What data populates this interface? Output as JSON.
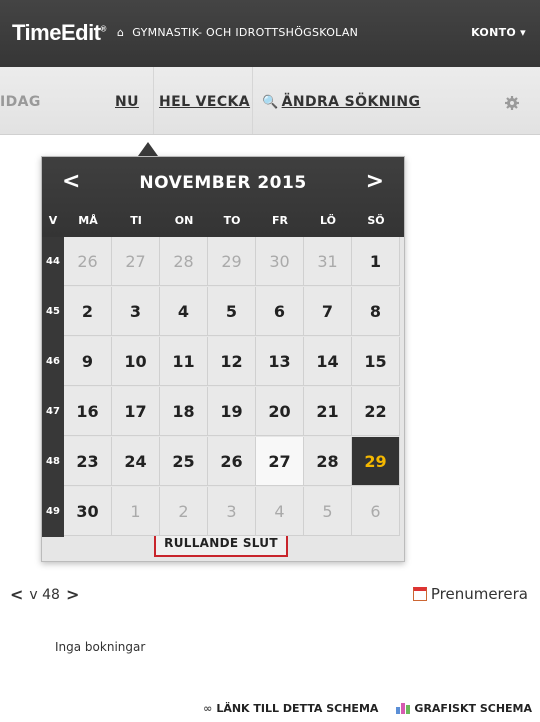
{
  "header": {
    "logo": "TimeEdit",
    "logo_mark": "®",
    "school": "GYMNASTIK- OCH IDROTTSHÖGSKOLAN",
    "account": "KONTO ▾"
  },
  "nav": {
    "idag": "IDAG",
    "nu": "NU",
    "hel_vecka": "HEL VECKA",
    "andra_sokning": "ÄNDRA SÖKNING"
  },
  "calendar": {
    "prev": "<",
    "next": ">",
    "title": "NOVEMBER 2015",
    "week_header": "V",
    "weekdays": [
      "MÅ",
      "TI",
      "ON",
      "TO",
      "FR",
      "LÖ",
      "SÖ"
    ],
    "weeks": [
      {
        "week": "44",
        "days": [
          {
            "d": "26",
            "other": true
          },
          {
            "d": "27",
            "other": true
          },
          {
            "d": "28",
            "other": true
          },
          {
            "d": "29",
            "other": true
          },
          {
            "d": "30",
            "other": true
          },
          {
            "d": "31",
            "other": true
          },
          {
            "d": "1"
          }
        ]
      },
      {
        "week": "45",
        "days": [
          {
            "d": "2"
          },
          {
            "d": "3"
          },
          {
            "d": "4"
          },
          {
            "d": "5"
          },
          {
            "d": "6"
          },
          {
            "d": "7"
          },
          {
            "d": "8"
          }
        ]
      },
      {
        "week": "46",
        "days": [
          {
            "d": "9"
          },
          {
            "d": "10"
          },
          {
            "d": "11"
          },
          {
            "d": "12"
          },
          {
            "d": "13"
          },
          {
            "d": "14"
          },
          {
            "d": "15"
          }
        ]
      },
      {
        "week": "47",
        "days": [
          {
            "d": "16"
          },
          {
            "d": "17"
          },
          {
            "d": "18"
          },
          {
            "d": "19"
          },
          {
            "d": "20"
          },
          {
            "d": "21"
          },
          {
            "d": "22"
          }
        ]
      },
      {
        "week": "48",
        "days": [
          {
            "d": "23"
          },
          {
            "d": "24"
          },
          {
            "d": "25"
          },
          {
            "d": "26"
          },
          {
            "d": "27",
            "today": true
          },
          {
            "d": "28"
          },
          {
            "d": "29",
            "selected": true
          }
        ]
      },
      {
        "week": "49",
        "days": [
          {
            "d": "30"
          },
          {
            "d": "1",
            "other": true
          },
          {
            "d": "2",
            "other": true
          },
          {
            "d": "3",
            "other": true
          },
          {
            "d": "4",
            "other": true
          },
          {
            "d": "5",
            "other": true
          },
          {
            "d": "6",
            "other": true
          }
        ]
      }
    ],
    "rolling_end": "RULLANDE SLUT"
  },
  "week_nav": {
    "prev": "<",
    "label": "v 48",
    "next": ">"
  },
  "subscribe": "Prenumerera",
  "empty_message": "Inga bokningar",
  "footer": {
    "link_schedule": "LÄNK TILL DETTA SCHEMA",
    "graphic_schedule": "GRAFISKT SCHEMA"
  },
  "colors": {
    "selected_day_text": "#f5b800",
    "header_bg": "#383838",
    "highlight_border": "#c8242b"
  }
}
